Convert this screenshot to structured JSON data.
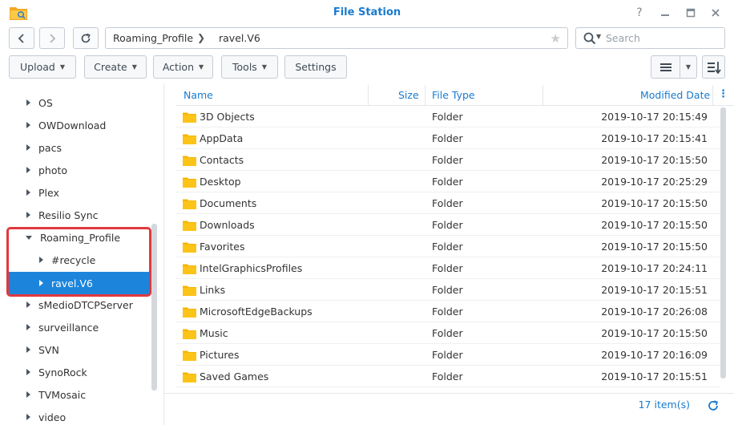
{
  "window": {
    "title": "File Station",
    "help_icon": "?",
    "icons": [
      "folder-app-icon",
      "help-icon",
      "minimize-icon",
      "maximize-icon",
      "close-icon"
    ]
  },
  "path": {
    "segments": [
      "Roaming_Profile",
      "ravel.V6"
    ]
  },
  "search": {
    "placeholder": "Search"
  },
  "toolbar": {
    "upload": "Upload",
    "create": "Create",
    "action": "Action",
    "tools": "Tools",
    "settings": "Settings"
  },
  "sidebar": {
    "items": [
      {
        "label": "OS"
      },
      {
        "label": "OWDownload"
      },
      {
        "label": "pacs"
      },
      {
        "label": "photo"
      },
      {
        "label": "Plex"
      },
      {
        "label": "Resilio Sync"
      },
      {
        "label": "Roaming_Profile",
        "expanded": true
      },
      {
        "label": "#recycle"
      },
      {
        "label": "ravel.V6",
        "selected": true
      },
      {
        "label": "sMedioDTCPServer"
      },
      {
        "label": "surveillance"
      },
      {
        "label": "SVN"
      },
      {
        "label": "SynoRock"
      },
      {
        "label": "TVMosaic"
      },
      {
        "label": "video"
      }
    ]
  },
  "filelist": {
    "columns": {
      "name": "Name",
      "size": "Size",
      "type": "File Type",
      "modified": "Modified Date"
    },
    "rows": [
      {
        "name": "3D Objects",
        "type": "Folder",
        "date": "2019-10-17 20:15:49"
      },
      {
        "name": "AppData",
        "type": "Folder",
        "date": "2019-10-17 20:15:41"
      },
      {
        "name": "Contacts",
        "type": "Folder",
        "date": "2019-10-17 20:15:50"
      },
      {
        "name": "Desktop",
        "type": "Folder",
        "date": "2019-10-17 20:25:29"
      },
      {
        "name": "Documents",
        "type": "Folder",
        "date": "2019-10-17 20:15:50"
      },
      {
        "name": "Downloads",
        "type": "Folder",
        "date": "2019-10-17 20:15:50"
      },
      {
        "name": "Favorites",
        "type": "Folder",
        "date": "2019-10-17 20:15:50"
      },
      {
        "name": "IntelGraphicsProfiles",
        "type": "Folder",
        "date": "2019-10-17 20:24:11"
      },
      {
        "name": "Links",
        "type": "Folder",
        "date": "2019-10-17 20:15:51"
      },
      {
        "name": "MicrosoftEdgeBackups",
        "type": "Folder",
        "date": "2019-10-17 20:26:08"
      },
      {
        "name": "Music",
        "type": "Folder",
        "date": "2019-10-17 20:15:50"
      },
      {
        "name": "Pictures",
        "type": "Folder",
        "date": "2019-10-17 20:16:09"
      },
      {
        "name": "Saved Games",
        "type": "Folder",
        "date": "2019-10-17 20:15:51"
      }
    ]
  },
  "footer": {
    "count": "17 item(s)"
  },
  "colors": {
    "accent": "#1a7bcf",
    "selected": "#1c85db",
    "highlight": "#e0393e",
    "folder": "#f7b500"
  }
}
